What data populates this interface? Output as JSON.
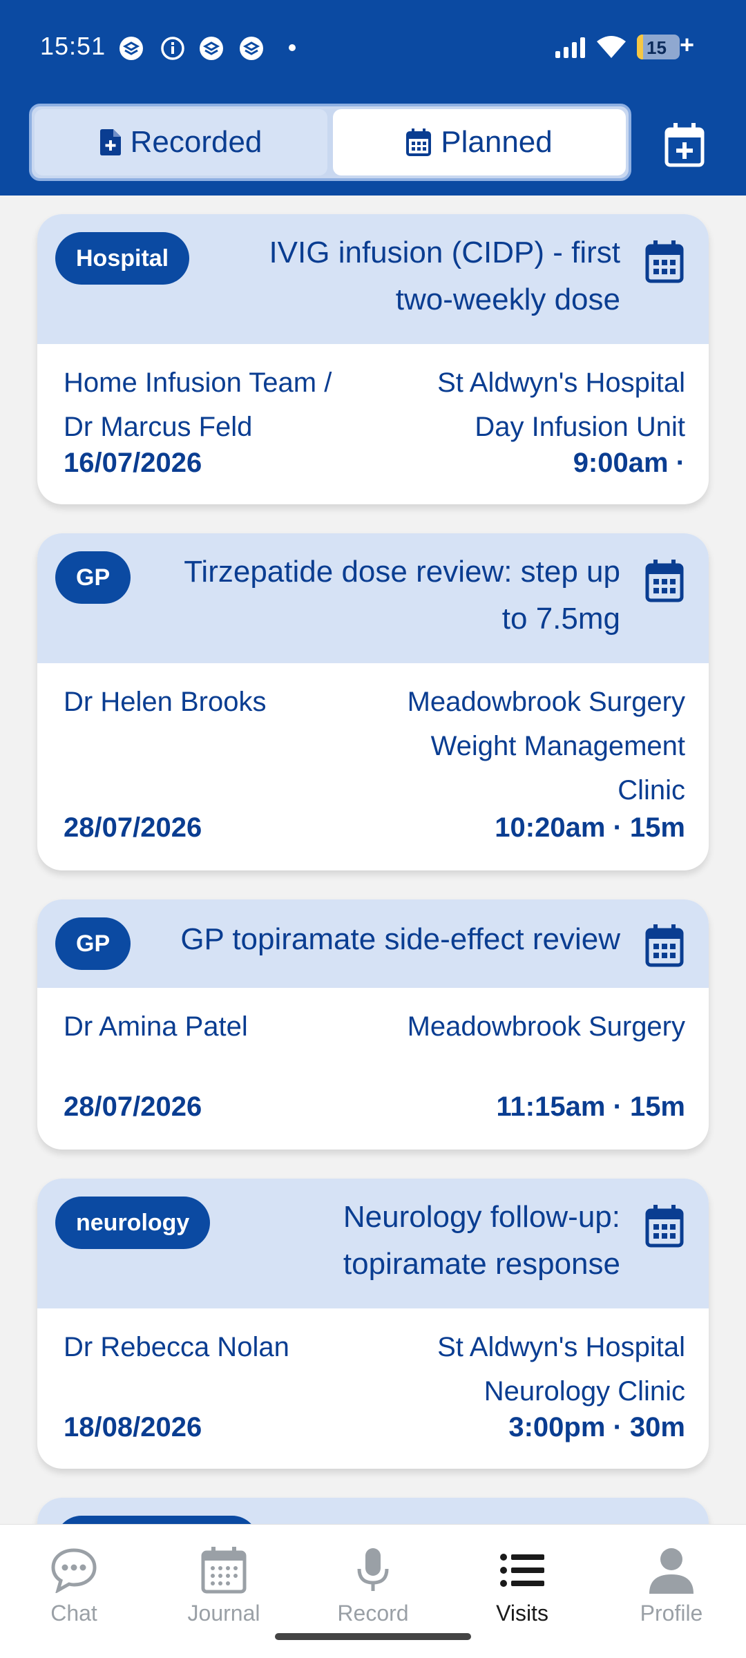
{
  "status_bar": {
    "time": "15:51",
    "battery": "15",
    "battery_level": 0.15
  },
  "tabs": [
    {
      "label": "Recorded",
      "icon": "file-plus-icon",
      "active": false
    },
    {
      "label": "Planned",
      "icon": "calendar-icon",
      "active": true
    }
  ],
  "visits": [
    {
      "tag": "Hospital",
      "title_lines": [
        "IVIG infusion (CIDP) - first",
        "two-weekly dose"
      ],
      "doctor_lines": [
        "Home Infusion Team /",
        "Dr Marcus Feld"
      ],
      "place_lines": [
        "St Aldwyn's Hospital",
        "Day Infusion Unit"
      ],
      "date": "16/07/2026",
      "when": "9:00am ·"
    },
    {
      "tag": "GP",
      "title_lines": [
        "Tirzepatide dose review: step up",
        "to 7.5mg"
      ],
      "doctor_lines": [
        "Dr Helen Brooks"
      ],
      "place_lines": [
        "Meadowbrook Surgery",
        "Weight Management",
        "Clinic"
      ],
      "date": "28/07/2026",
      "when": "10:20am · 15m"
    },
    {
      "tag": "GP",
      "title_lines": [
        "GP topiramate side-effect review"
      ],
      "doctor_lines": [
        "Dr Amina Patel"
      ],
      "place_lines": [
        "Meadowbrook Surgery"
      ],
      "date": "28/07/2026",
      "when": "11:15am · 15m"
    },
    {
      "tag": "neurology",
      "title_lines": [
        "Neurology follow-up:",
        "topiramate response"
      ],
      "doctor_lines": [
        "Dr Rebecca Nolan"
      ],
      "place_lines": [
        "St Aldwyn's Hospital",
        "Neurology Clinic"
      ],
      "date": "18/08/2026",
      "when": "3:00pm · 30m"
    }
  ],
  "bottom_nav": [
    {
      "label": "Chat",
      "icon": "chat-bubble-icon",
      "active": false
    },
    {
      "label": "Journal",
      "icon": "calendar-grid-icon",
      "active": false
    },
    {
      "label": "Record",
      "icon": "microphone-icon",
      "active": false
    },
    {
      "label": "Visits",
      "icon": "list-icon",
      "active": true
    },
    {
      "label": "Profile",
      "icon": "person-icon",
      "active": false
    }
  ],
  "colors": {
    "header": "#0b4aa2",
    "accent_text": "#0a3d91",
    "card_head": "#d6e2f5"
  }
}
